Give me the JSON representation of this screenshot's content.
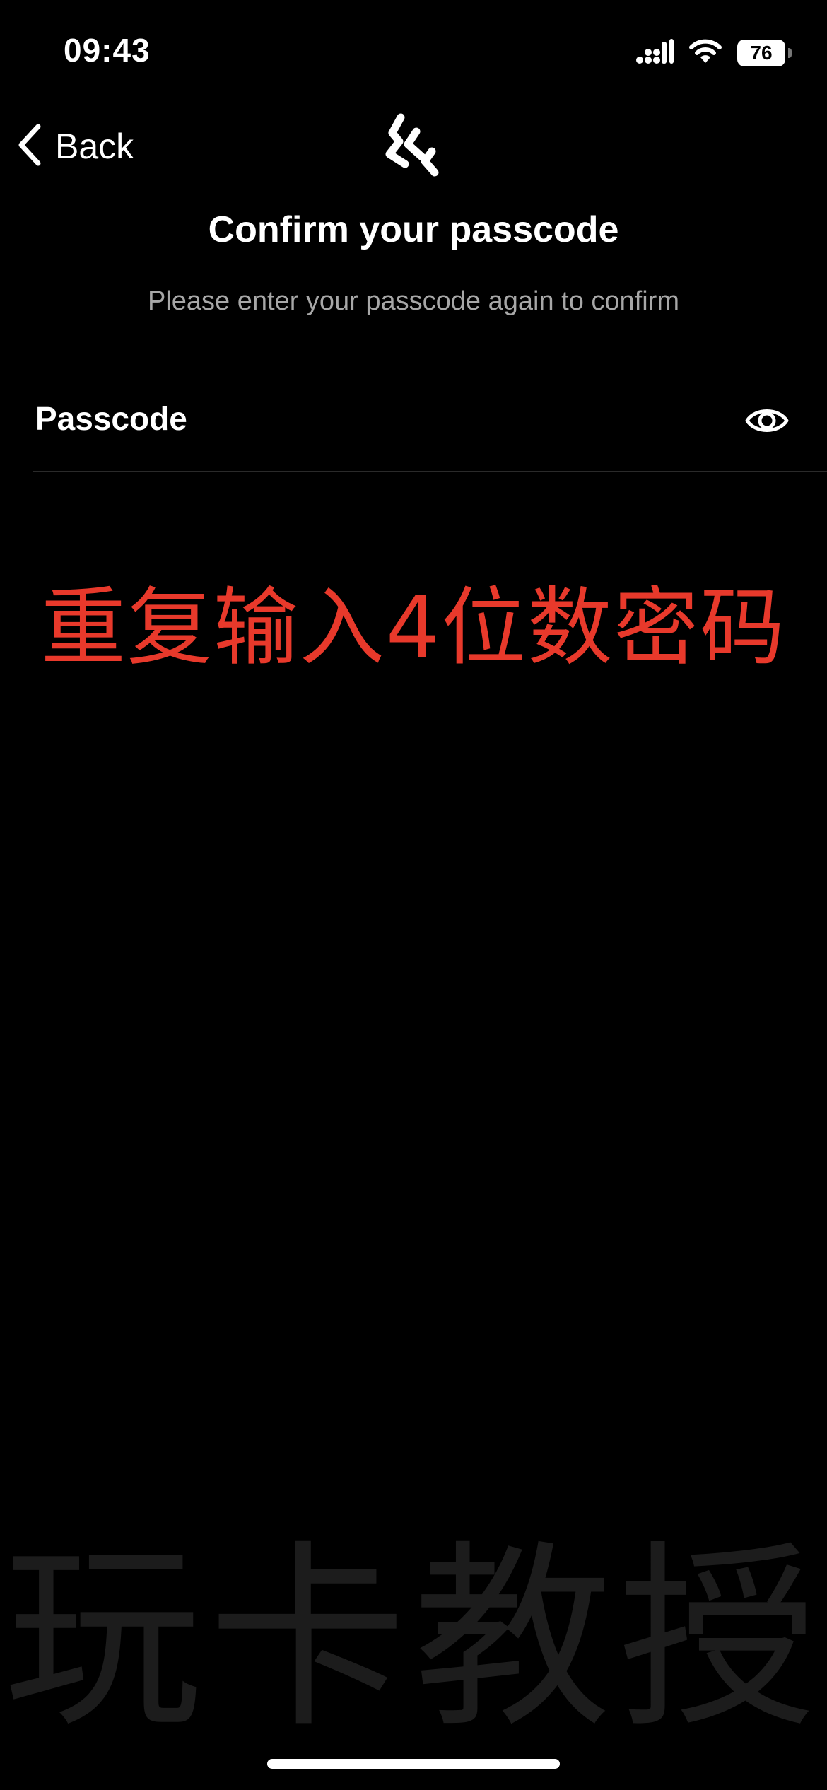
{
  "status_bar": {
    "time": "09:43",
    "battery": "76",
    "icons": [
      "cellular-signal-icon",
      "wifi-icon",
      "battery-icon"
    ]
  },
  "nav": {
    "back_label": "Back",
    "logo_icon": "brand-logo-icon"
  },
  "header": {
    "title": "Confirm your passcode",
    "subtitle": "Please enter your passcode again to confirm"
  },
  "passcode_field": {
    "label": "Passcode",
    "value": "",
    "toggle_icon": "eye-icon"
  },
  "annotation": {
    "text": "重复输入4位数密码",
    "color": "#e8392b"
  },
  "watermark": {
    "text": "玩卡教授"
  }
}
